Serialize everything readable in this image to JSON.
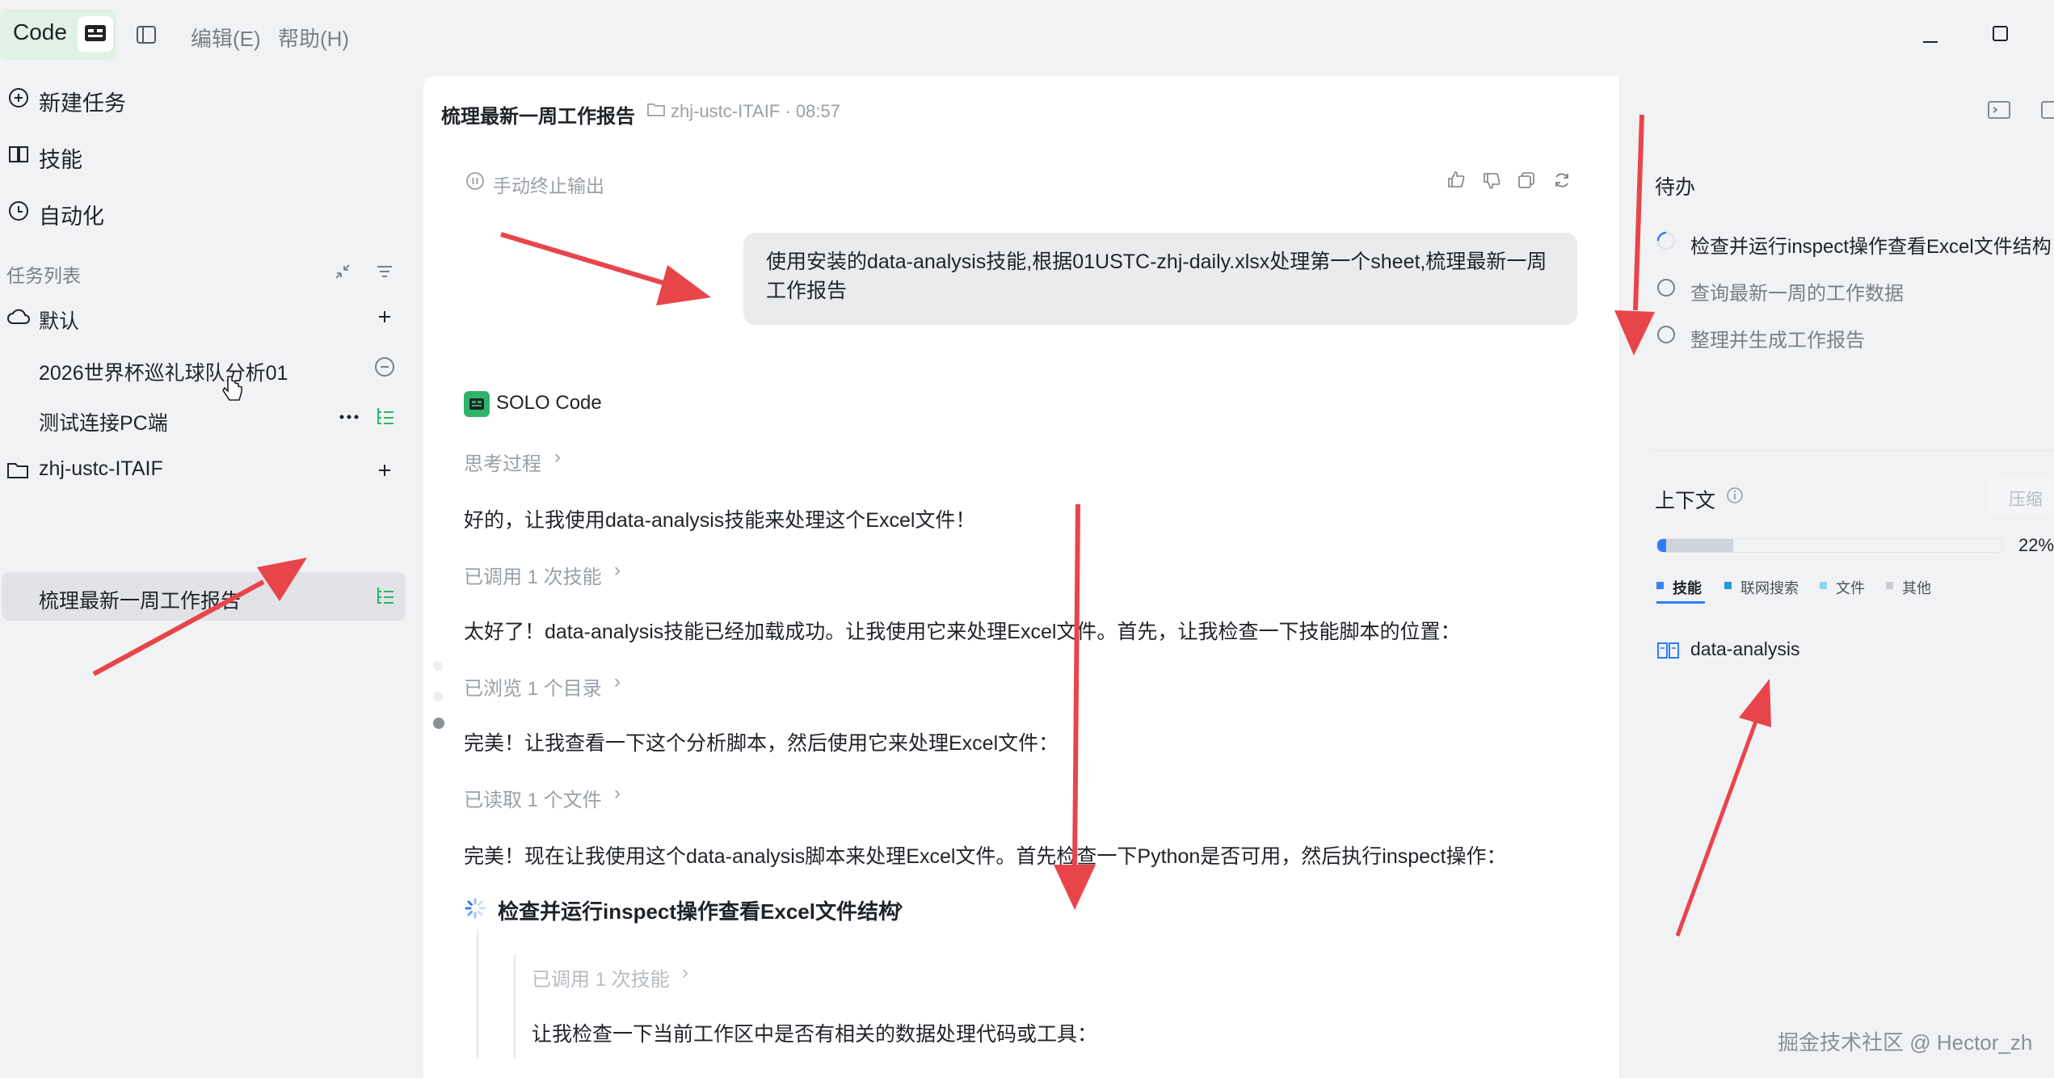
{
  "titlebar": {
    "app_name": "Code",
    "menu": [
      "编辑(E)",
      "帮助(H)"
    ]
  },
  "sidebar": {
    "actions": [
      {
        "label": "新建任务",
        "icon": "plus-circle-icon"
      },
      {
        "label": "技能",
        "icon": "book-icon"
      },
      {
        "label": "自动化",
        "icon": "clock-icon"
      }
    ],
    "task_list_label": "任务列表",
    "groups": [
      {
        "name": "默认",
        "icon": "cloud-icon",
        "tasks": [
          "2026世界杯巡礼球队分析01",
          "测试连接PC端"
        ]
      },
      {
        "name": "zhj-ustc-ITAIF",
        "icon": "folder-icon",
        "tasks": [
          "梳理最新一周工作报告"
        ]
      }
    ]
  },
  "header": {
    "title": "梳理最新一周工作报告",
    "project": "zhj-ustc-ITAIF · 08:57"
  },
  "chat": {
    "stop_label": "手动终止输出",
    "user_message": "使用安装的data-analysis技能,根据01USTC-zhj-daily.xlsx处理第一个sheet,梳理最新一周工作报告",
    "agent_name": "SOLO Code",
    "thinking_label": "思考过程",
    "messages": [
      "好的，让我使用data-analysis技能来处理这个Excel文件！",
      "太好了！data-analysis技能已经加载成功。让我使用它来处理Excel文件。首先，让我检查一下技能脚本的位置：",
      "完美！让我查看一下这个分析脚本，然后使用它来处理Excel文件：",
      "完美！现在让我使用这个data-analysis脚本来处理Excel文件。首先检查一下Python是否可用，然后执行inspect操作："
    ],
    "tool_calls": [
      "已调用 1 次技能",
      "已浏览 1 个目录",
      "已读取 1 个文件"
    ],
    "current_step": "检查并运行inspect操作查看Excel文件结构",
    "sub_tool_call": "已调用 1 次技能",
    "sub_message": "让我检查一下当前工作区中是否有相关的数据处理代码或工具："
  },
  "todo": {
    "heading": "待办",
    "items": [
      {
        "text": "检查并运行inspect操作查看Excel文件结构",
        "status": "running"
      },
      {
        "text": "查询最新一周的工作数据",
        "status": "pending"
      },
      {
        "text": "整理并生成工作报告",
        "status": "pending"
      }
    ]
  },
  "context": {
    "heading": "上下文",
    "compress_label": "压缩",
    "usage_percent": "22%",
    "usage_fraction": 0.22,
    "legend": [
      {
        "label": "技能",
        "color": "#3b82f6"
      },
      {
        "label": "联网搜索",
        "color": "#1d9bd7"
      },
      {
        "label": "文件",
        "color": "#8fd3f4"
      },
      {
        "label": "其他",
        "color": "#c9ccd1"
      }
    ],
    "skill": "data-analysis"
  },
  "watermark": "掘金技术社区 @ Hector_zh",
  "colors": {
    "accent_green": "#2fb36b",
    "arrow_red": "#e8454b",
    "bar_blue": "#2f7df6"
  }
}
